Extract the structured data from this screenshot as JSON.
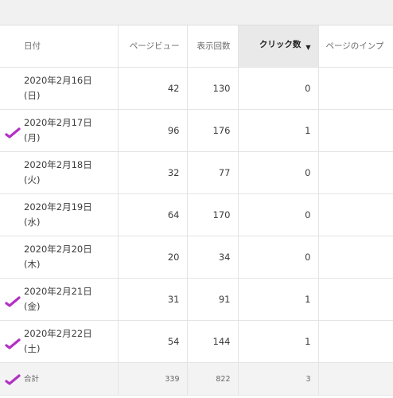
{
  "table": {
    "headers": {
      "date": "日付",
      "pageviews": "ページビュー",
      "impressions": "表示回数",
      "clicks": "クリック数",
      "page_impressions": "ページのインプ"
    },
    "rows": [
      {
        "date": "2020年2月16日",
        "weekday": "(日)",
        "pageviews": "42",
        "impressions": "130",
        "clicks": "0",
        "checked": false
      },
      {
        "date": "2020年2月17日",
        "weekday": "(月)",
        "pageviews": "96",
        "impressions": "176",
        "clicks": "1",
        "checked": true
      },
      {
        "date": "2020年2月18日",
        "weekday": "(火)",
        "pageviews": "32",
        "impressions": "77",
        "clicks": "0",
        "checked": false
      },
      {
        "date": "2020年2月19日",
        "weekday": "(水)",
        "pageviews": "64",
        "impressions": "170",
        "clicks": "0",
        "checked": false
      },
      {
        "date": "2020年2月20日",
        "weekday": "(木)",
        "pageviews": "20",
        "impressions": "34",
        "clicks": "0",
        "checked": false
      },
      {
        "date": "2020年2月21日",
        "weekday": "(金)",
        "pageviews": "31",
        "impressions": "91",
        "clicks": "1",
        "checked": true
      },
      {
        "date": "2020年2月22日",
        "weekday": "(土)",
        "pageviews": "54",
        "impressions": "144",
        "clicks": "1",
        "checked": true
      }
    ],
    "total": {
      "label": "合計",
      "pageviews": "339",
      "impressions": "822",
      "clicks": "3",
      "checked": true
    }
  },
  "colors": {
    "annotation": "#b230c4",
    "sorted_header": "#e9e9e9",
    "total_row": "#f3f3f3"
  },
  "icons": {
    "sort": "sort-descending-icon",
    "annotation": "checkmark-annotation-icon"
  }
}
